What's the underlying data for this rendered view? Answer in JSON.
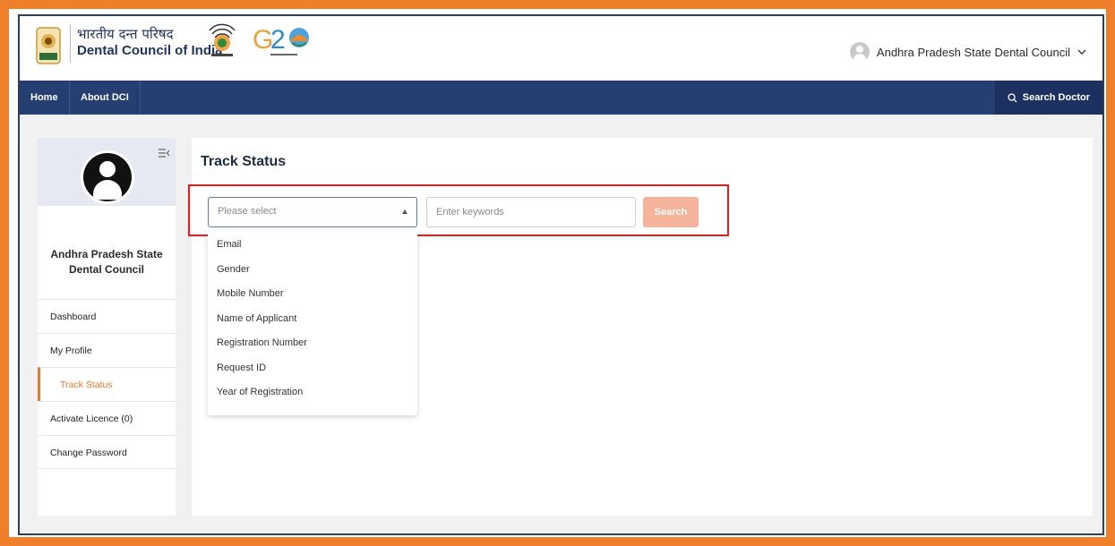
{
  "brand": {
    "hindi_name": "भारतीय दन्त परिषद",
    "english_name": "Dental Council of India"
  },
  "user_menu": {
    "name": "Andhra Pradesh State Dental Council",
    "chevron_icon": "chevron-down-icon"
  },
  "navbar": {
    "home": "Home",
    "about": "About DCI",
    "search_doctor": "Search Doctor",
    "search_icon": "search-icon"
  },
  "sidebar": {
    "profile_name": "Andhra Pradesh State Dental Council",
    "menu": [
      {
        "label": "Dashboard"
      },
      {
        "label": "My Profile"
      },
      {
        "label": "Track Status"
      },
      {
        "label": "Activate Licence (0)"
      },
      {
        "label": "Change Password"
      }
    ],
    "active_index": 2
  },
  "main": {
    "title": "Track Status",
    "select_placeholder": "Please select",
    "keyword_placeholder": "Enter keywords",
    "search_button": "Search",
    "dropdown_options": [
      "Email",
      "Gender",
      "Mobile Number",
      "Name of Applicant",
      "Registration Number",
      "Request ID",
      "Year of Registration"
    ]
  },
  "colors": {
    "frame": "#ef7f2a",
    "navbar": "#263f73",
    "accent": "#e8792b",
    "search_button": "#f5b49a",
    "highlight": "#e41e20"
  }
}
